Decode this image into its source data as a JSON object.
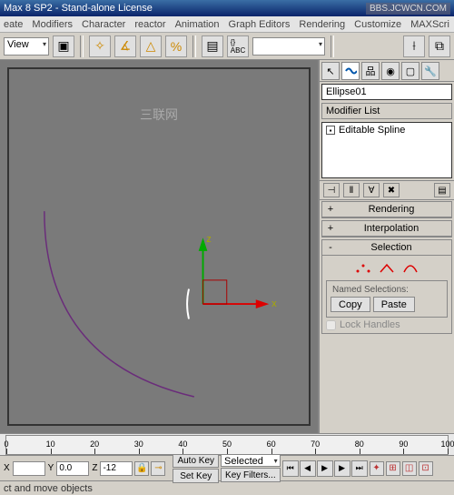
{
  "title": "Max 8 SP2 - Stand-alone License",
  "watermark_url": "BBS.JCWCN.COM",
  "viewport_watermark": "三联网",
  "menu": [
    "eate",
    "Modifiers",
    "Character",
    "reactor",
    "Animation",
    "Graph Editors",
    "Rendering",
    "Customize",
    "MAXScri"
  ],
  "toolbar": {
    "view_combo": "View"
  },
  "object": {
    "name": "Ellipse01",
    "modifier_list_label": "Modifier List",
    "stack_item": "Editable Spline"
  },
  "rollouts": {
    "rendering": "Rendering",
    "interpolation": "Interpolation",
    "selection": "Selection"
  },
  "named_sel": {
    "title": "Named Selections:",
    "copy": "Copy",
    "paste": "Paste"
  },
  "lock_handles": "Lock Handles",
  "timeline": {
    "ticks": [
      "0",
      "10",
      "20",
      "30",
      "40",
      "50",
      "60",
      "70",
      "80",
      "90",
      "100"
    ]
  },
  "xyz": {
    "x_lbl": "X",
    "y_lbl": "Y",
    "z_lbl": "Z",
    "x": "",
    "y": "0.0",
    "z": "-12"
  },
  "keys": {
    "auto": "Auto Key",
    "set": "Set Key",
    "selected": "Selected",
    "filters": "Key Filters..."
  },
  "status": "ct and move objects"
}
